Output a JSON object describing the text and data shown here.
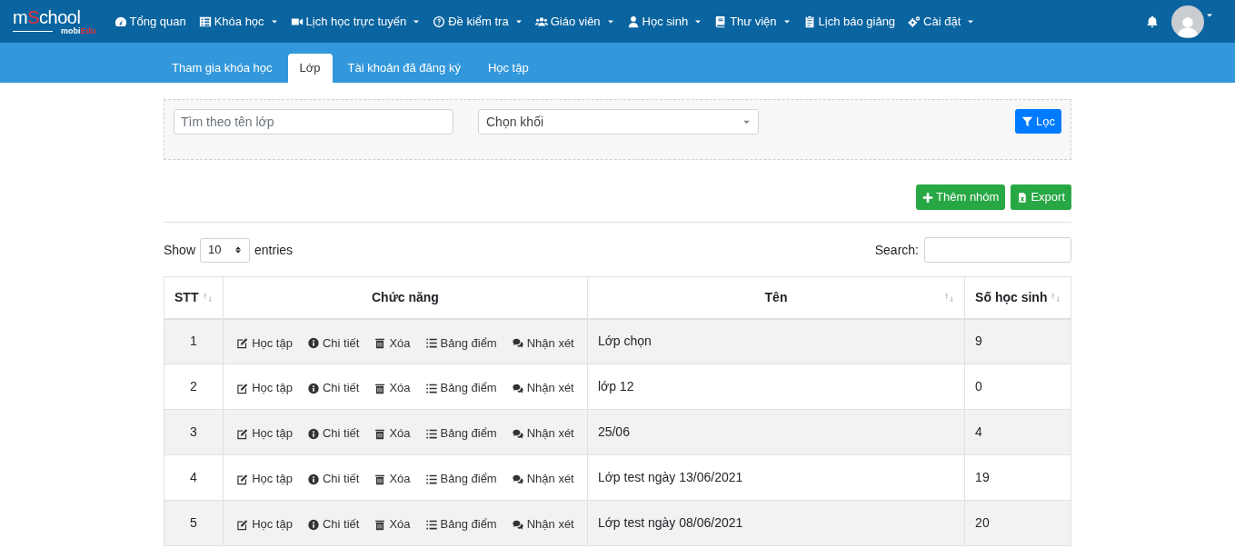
{
  "logo": {
    "parts": [
      "m",
      "S",
      "chool"
    ],
    "sub_parts": [
      "mobi",
      "Edu"
    ]
  },
  "nav": [
    {
      "label": "Tổng quan",
      "dropdown": false
    },
    {
      "label": "Khóa học",
      "dropdown": true
    },
    {
      "label": "Lịch học trực tuyến",
      "dropdown": true
    },
    {
      "label": "Đề kiểm tra",
      "dropdown": true
    },
    {
      "label": "Giáo viên",
      "dropdown": true
    },
    {
      "label": "Học sinh",
      "dropdown": true
    },
    {
      "label": "Thư viện",
      "dropdown": true
    },
    {
      "label": "Lịch báo giảng",
      "dropdown": false
    },
    {
      "label": "Cài đặt",
      "dropdown": true
    }
  ],
  "tabs": [
    {
      "label": "Tham gia khóa học",
      "selected": false
    },
    {
      "label": "Lớp",
      "selected": true
    },
    {
      "label": "Tài khoản đã đăng ký",
      "selected": false
    },
    {
      "label": "Học tập",
      "selected": false
    }
  ],
  "filter": {
    "search": {
      "placeholder": "Tìm theo tên lớp"
    },
    "grade_select": {
      "value": "Chọn khối"
    },
    "filter_button": "Lọc"
  },
  "actions": [
    "Thêm nhóm",
    "Export"
  ],
  "length": {
    "label_before": "Show",
    "value": "10",
    "label_after": "entries"
  },
  "search_label": "Search:",
  "table": {
    "columns": [
      {
        "label": "STT",
        "sortable": true
      },
      {
        "label": "Chức năng",
        "sortable": false
      },
      {
        "label": "Tên",
        "sortable": true
      },
      {
        "label": "Số học sinh",
        "sortable": true
      }
    ],
    "rows": [
      {
        "stt": "1",
        "actions": [
          "Học tập",
          "Chi tiết",
          "Xóa",
          "Bảng điểm",
          "Nhận xét"
        ],
        "name": "Lớp chọn",
        "students": "9"
      },
      {
        "stt": "2",
        "actions": [
          "Học tập",
          "Chi tiết",
          "Xóa",
          "Bảng điểm",
          "Nhận xét"
        ],
        "name": "lớp 12",
        "students": "0"
      },
      {
        "stt": "3",
        "actions": [
          "Học tập",
          "Chi tiết",
          "Xóa",
          "Bảng điểm",
          "Nhận xét"
        ],
        "name": "25/06",
        "students": "4"
      },
      {
        "stt": "4",
        "actions": [
          "Học tập",
          "Chi tiết",
          "Xóa",
          "Bảng điểm",
          "Nhận xét"
        ],
        "name": "Lớp test ngày 13/06/2021",
        "students": "19"
      },
      {
        "stt": "5",
        "actions": [
          "Học tập",
          "Chi tiết",
          "Xóa",
          "Bảng điểm",
          "Nhận xét"
        ],
        "name": "Lớp test ngày 08/06/2021",
        "students": "20"
      }
    ]
  }
}
